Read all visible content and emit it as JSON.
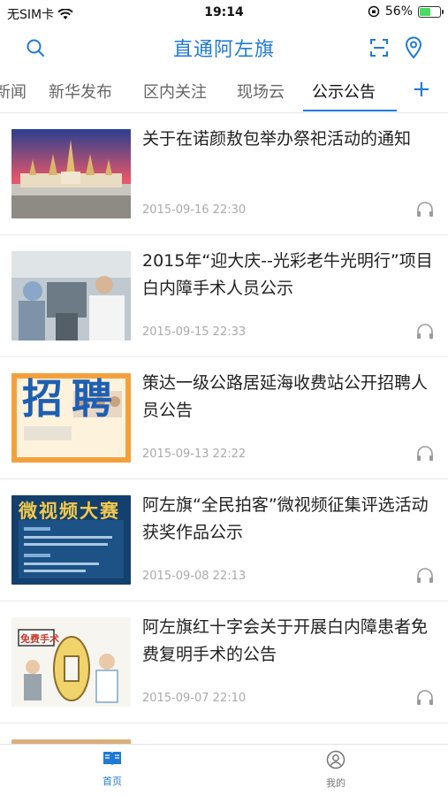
{
  "status_bar": {
    "carrier": "无SIM卡",
    "time": "19:14",
    "battery_percent": "56%",
    "battery_level": 0.56
  },
  "header": {
    "title": "直通阿左旗"
  },
  "tabs": [
    {
      "label": "新闻"
    },
    {
      "label": "新华发布"
    },
    {
      "label": "区内关注"
    },
    {
      "label": "现场云"
    },
    {
      "label": "公示公告"
    }
  ],
  "active_tab": "公示公告",
  "add_tab_label": "+",
  "articles": [
    {
      "title": "关于在诺颜敖包举办祭祀活动的通知",
      "date": "2015-09-16 22:30",
      "thumb_text": ""
    },
    {
      "title": "2015年“迎大庆--光彩老牛光明行”项目白内障手术人员公示",
      "date": "2015-09-15 22:33",
      "thumb_text": ""
    },
    {
      "title": "策达一级公路居延海收费站公开招聘人员公告",
      "date": "2015-09-13 22:22",
      "thumb_text": "招聘"
    },
    {
      "title": "阿左旗“全民拍客”微视频征集评选活动获奖作品公示",
      "date": "2015-09-08 22:13",
      "thumb_text": "微视频大赛"
    },
    {
      "title": "阿左旗红十字会关于开展白内障患者免费复明手术的公告",
      "date": "2015-09-07 22:10",
      "thumb_text": "免费手术"
    }
  ],
  "tabbar": {
    "home_label": "首页",
    "mine_label": "我的"
  },
  "colors": {
    "accent": "#1f7ad6",
    "date": "#aaaaaa"
  }
}
